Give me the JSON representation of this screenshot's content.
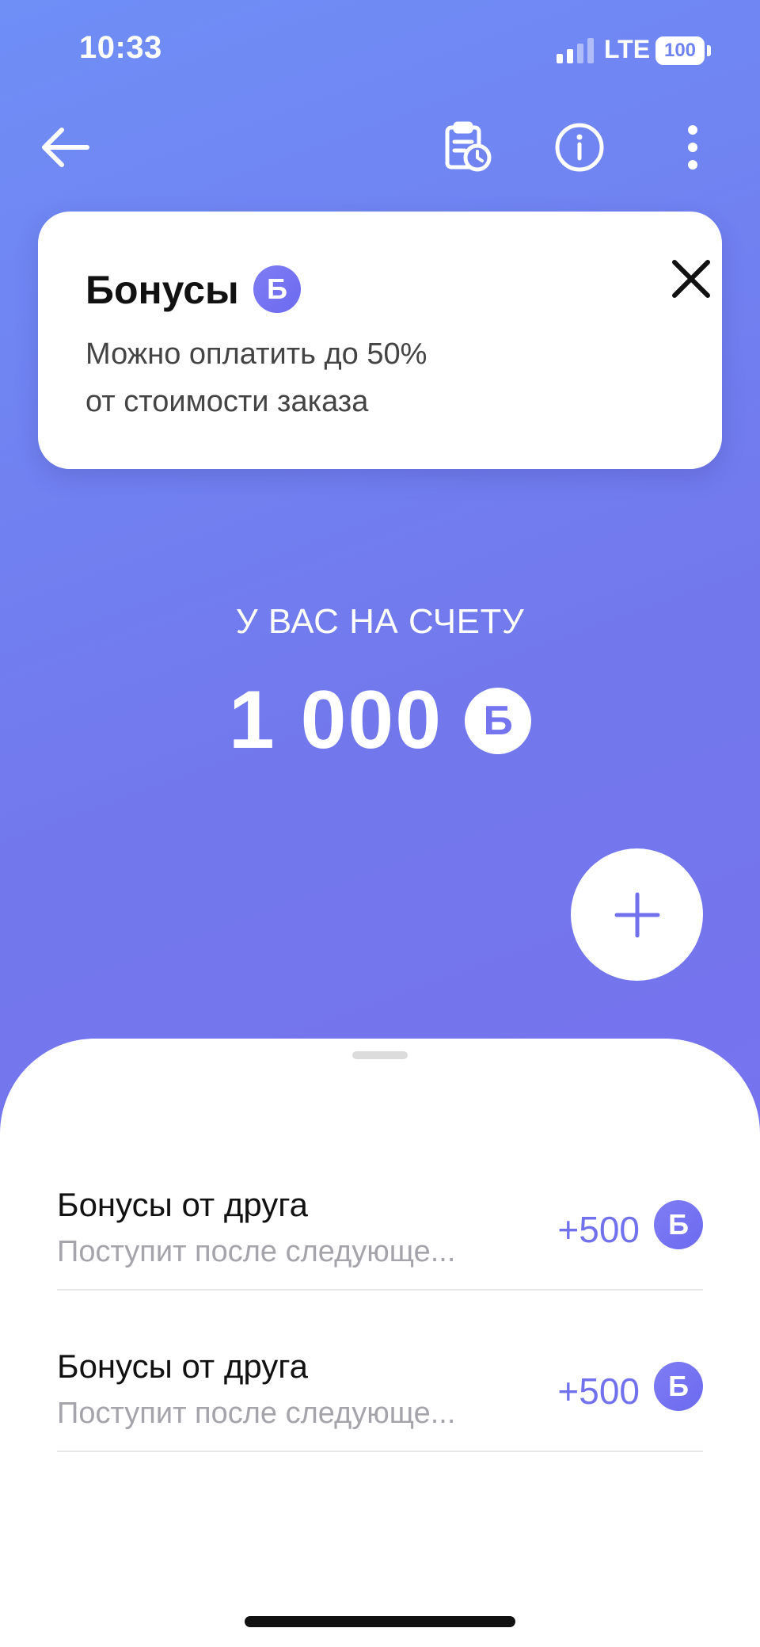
{
  "status_bar": {
    "time": "10:33",
    "network": "LTE",
    "battery": "100"
  },
  "toolbar": {
    "back_icon": "arrow-left-icon",
    "history_icon": "clipboard-clock-icon",
    "info_icon": "info-icon",
    "more_icon": "more-vertical-icon"
  },
  "tooltip": {
    "title": "Бонусы",
    "badge": "Б",
    "line1": "Можно оплатить до 50%",
    "line2": "от стоимости заказа",
    "close_icon": "close-icon"
  },
  "balance": {
    "label": "У ВАС НА СЧЕТУ",
    "amount": "1 000",
    "currency": "Б"
  },
  "add_button_icon": "plus-icon",
  "transactions": [
    {
      "title": "Бонусы от друга",
      "subtitle": "Поступит после следующе...",
      "amount": "+500",
      "currency": "Б"
    },
    {
      "title": "Бонусы от друга",
      "subtitle": "Поступит после следующе...",
      "amount": "+500",
      "currency": "Б"
    }
  ],
  "colors": {
    "accent": "#7171ee",
    "background_start": "#6f8ef6",
    "background_end": "#7a6ef0"
  }
}
